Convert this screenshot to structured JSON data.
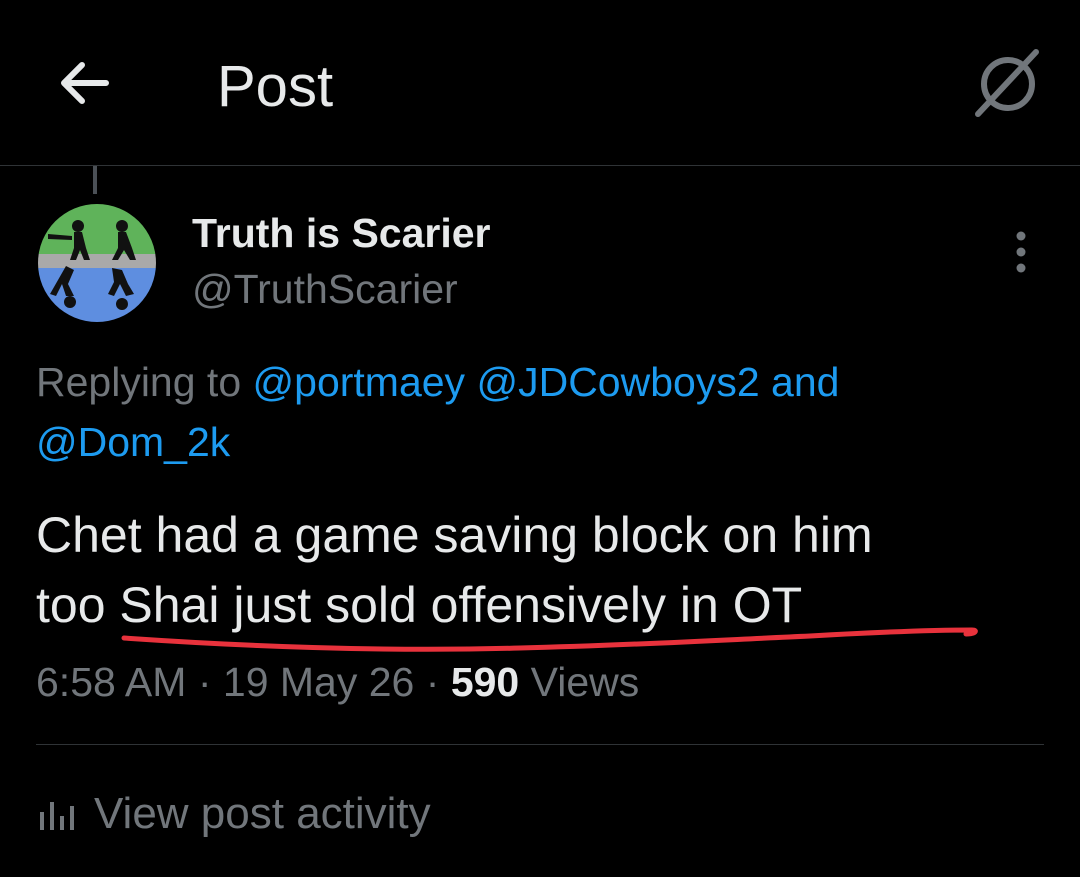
{
  "header": {
    "title": "Post",
    "back_icon": "arrow-left-icon",
    "grok_icon": "grok-icon"
  },
  "post": {
    "author": {
      "display_name": "Truth is Scarier",
      "handle": "@TruthScarier",
      "avatar_icon": "avatar-figures-image"
    },
    "replying_prefix": "Replying to",
    "mentions": [
      "@portmaey",
      "@JDCowboys2"
    ],
    "mentions_joiner": "and",
    "mention_last": "@Dom_2k",
    "text_line1": "Chet had a game saving block on him",
    "text_line2": "too Shai just sold offensively in OT",
    "time": "6:58 AM",
    "date": "19 May 26",
    "separator": "·",
    "views_count": "590",
    "views_label": "Views",
    "more_icon": "more-vertical-icon"
  },
  "activity": {
    "label": "View post activity",
    "icon": "bar-chart-icon"
  },
  "colors": {
    "background": "#000000",
    "text_primary": "#e7e9ea",
    "text_secondary": "#71767b",
    "link": "#1d9bf0",
    "annotation": "#e8323c",
    "divider": "#2f3336"
  }
}
